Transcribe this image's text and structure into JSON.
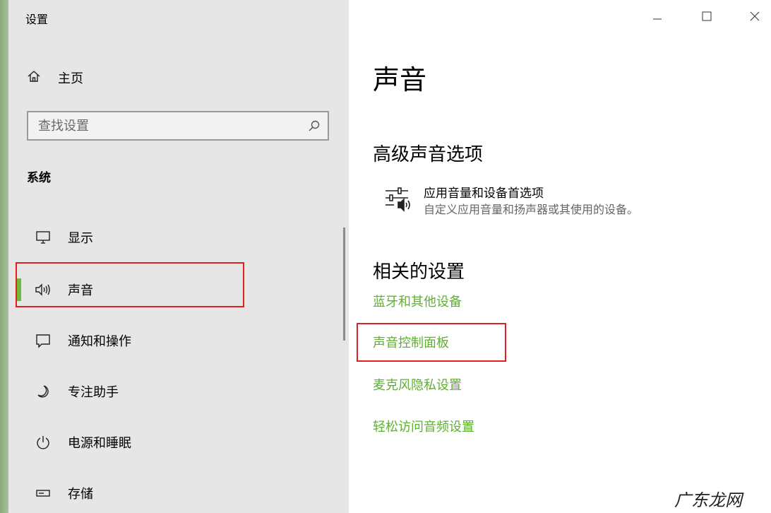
{
  "window": {
    "title": "设置"
  },
  "sidebar": {
    "home_label": "主页",
    "search_placeholder": "查找设置",
    "section_title": "系统",
    "items": [
      {
        "label": "显示",
        "icon": "monitor-icon"
      },
      {
        "label": "声音",
        "icon": "speaker-icon",
        "active": true
      },
      {
        "label": "通知和操作",
        "icon": "notification-icon"
      },
      {
        "label": "专注助手",
        "icon": "moon-icon"
      },
      {
        "label": "电源和睡眠",
        "icon": "power-icon"
      },
      {
        "label": "存储",
        "icon": "storage-icon"
      }
    ]
  },
  "main": {
    "page_title": "声音",
    "advanced_title": "高级声音选项",
    "app_volume": {
      "title": "应用音量和设备首选项",
      "description": "自定义应用音量和扬声器或其使用的设备。",
      "icon": "volume-mixer-icon"
    },
    "related_title": "相关的设置",
    "links": [
      "蓝牙和其他设备",
      "声音控制面板",
      "麦克风隐私设置",
      "轻松访问音频设置"
    ]
  },
  "watermark": "广东龙网",
  "colors": {
    "accent": "#5db12f",
    "highlight": "#e02020",
    "sidebar_bg": "#e6e6e6"
  }
}
